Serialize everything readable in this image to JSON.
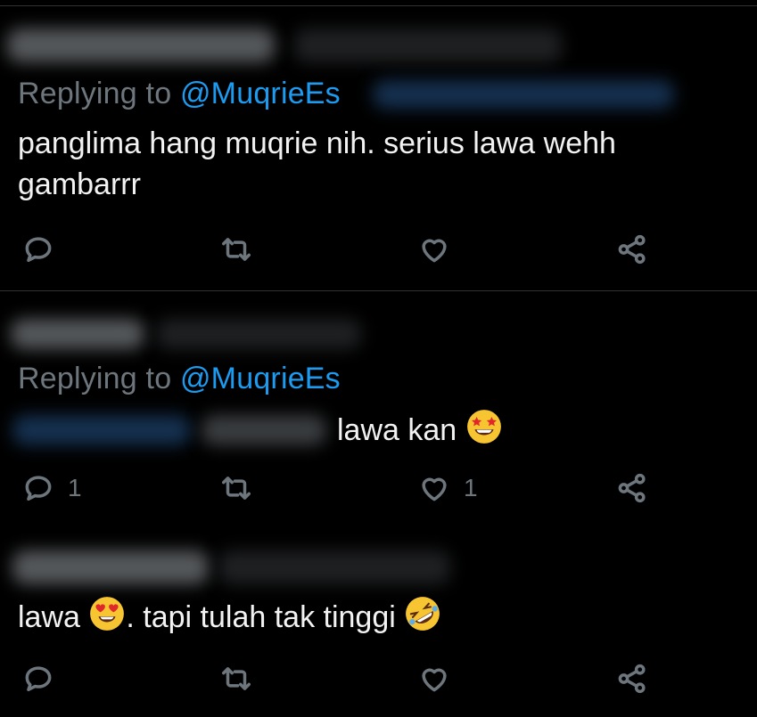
{
  "colors": {
    "background": "#000000",
    "text": "#f2f2f2",
    "muted": "#6e767d",
    "accent": "#1d9bf0",
    "divider": "#2f3336"
  },
  "tweets": [
    {
      "replying_label": "Replying to",
      "handle": "@MuqrieEs",
      "text_line1": "panglima hang muqrie nih. serius lawa wehh",
      "text_line2": "gambarrr",
      "reply_count": "",
      "like_count": ""
    },
    {
      "replying_label": "Replying to",
      "handle": "@MuqrieEs",
      "text": "lawa kan",
      "emoji": "star-struck-emoji",
      "reply_count": "1",
      "like_count": "1"
    },
    {
      "text_part1": "lawa",
      "emoji1": "heart-eyes-emoji",
      "text_part2": ". tapi tulah tak tinggi",
      "emoji2": "rolling-laughing-emoji",
      "reply_count": "",
      "like_count": ""
    }
  ],
  "icons": {
    "reply": "reply-icon",
    "retweet": "retweet-icon",
    "like": "heart-icon",
    "share": "share-icon"
  }
}
